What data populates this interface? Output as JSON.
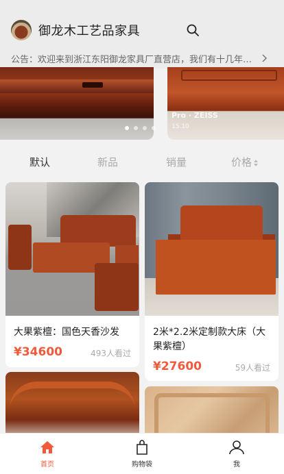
{
  "header": {
    "shop_name": "御龙木工艺品家具",
    "notice": "公告：欢迎来到浙江东阳御龙家具厂直营店，我们有十几年的红木家具生产经验"
  },
  "banner": {
    "watermark": "Pro · ZEISS",
    "watermark_sub": "15.10"
  },
  "sort_tabs": {
    "default": "默认",
    "new": "新品",
    "sales": "销量",
    "price": "价格"
  },
  "products": [
    {
      "title": "大果紫檀：国色天香沙发",
      "price": "¥34600",
      "views": "493人看过"
    },
    {
      "title": "2米*2.2米定制款大床（大果紫檀）",
      "price": "¥27600",
      "views": "59人看过"
    }
  ],
  "tabbar": {
    "home": "首页",
    "cart": "购物袋",
    "me": "我"
  },
  "colors": {
    "accent": "#f05a3c"
  }
}
